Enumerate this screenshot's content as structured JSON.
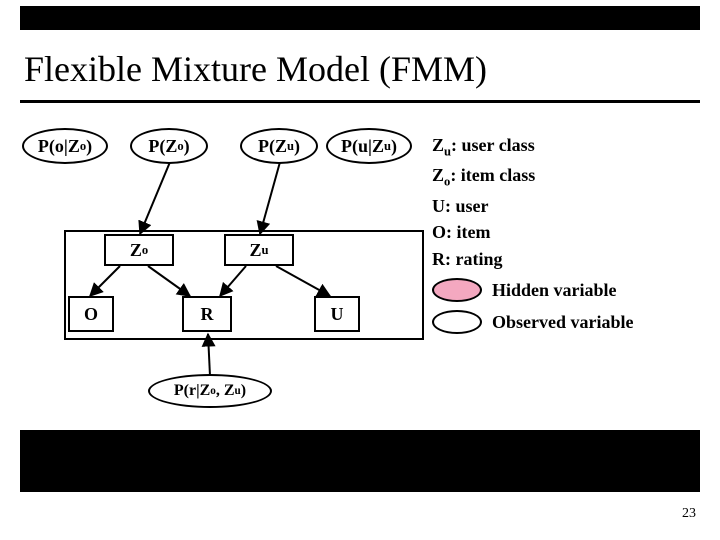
{
  "slide": {
    "title": "Flexible Mixture Model (FMM)",
    "page_number": "23"
  },
  "nodes": {
    "p_o_given_zo": {
      "html": "P(o|Z<sub>o</sub>)"
    },
    "p_zo": {
      "html": "P(Z<sub>o</sub>)"
    },
    "p_zu": {
      "html": "P(Z<sub>u</sub>)"
    },
    "p_u_given_zu": {
      "html": "P(u|Z<sub>u</sub>)"
    },
    "zo": {
      "html": "Z<sub>o</sub>"
    },
    "zu": {
      "html": "Z<sub>u</sub>"
    },
    "o": {
      "html": "O"
    },
    "r": {
      "html": "R"
    },
    "u": {
      "html": "U"
    },
    "p_r_given_zo_zu": {
      "html": "P(r|Z<sub>o</sub>, Z<sub>u</sub>)"
    }
  },
  "legend": {
    "zu_desc": {
      "html": "Z<sub>u</sub>: user class"
    },
    "zo_desc": {
      "html": "Z<sub>o</sub>: item class"
    },
    "u_desc": {
      "html": "U: user"
    },
    "o_desc": {
      "html": "O: item"
    },
    "r_desc": {
      "html": "R: rating"
    },
    "hidden": {
      "html": "Hidden variable"
    },
    "observed": {
      "html": "Observed variable"
    },
    "hidden_color": "#f4a8c0"
  }
}
